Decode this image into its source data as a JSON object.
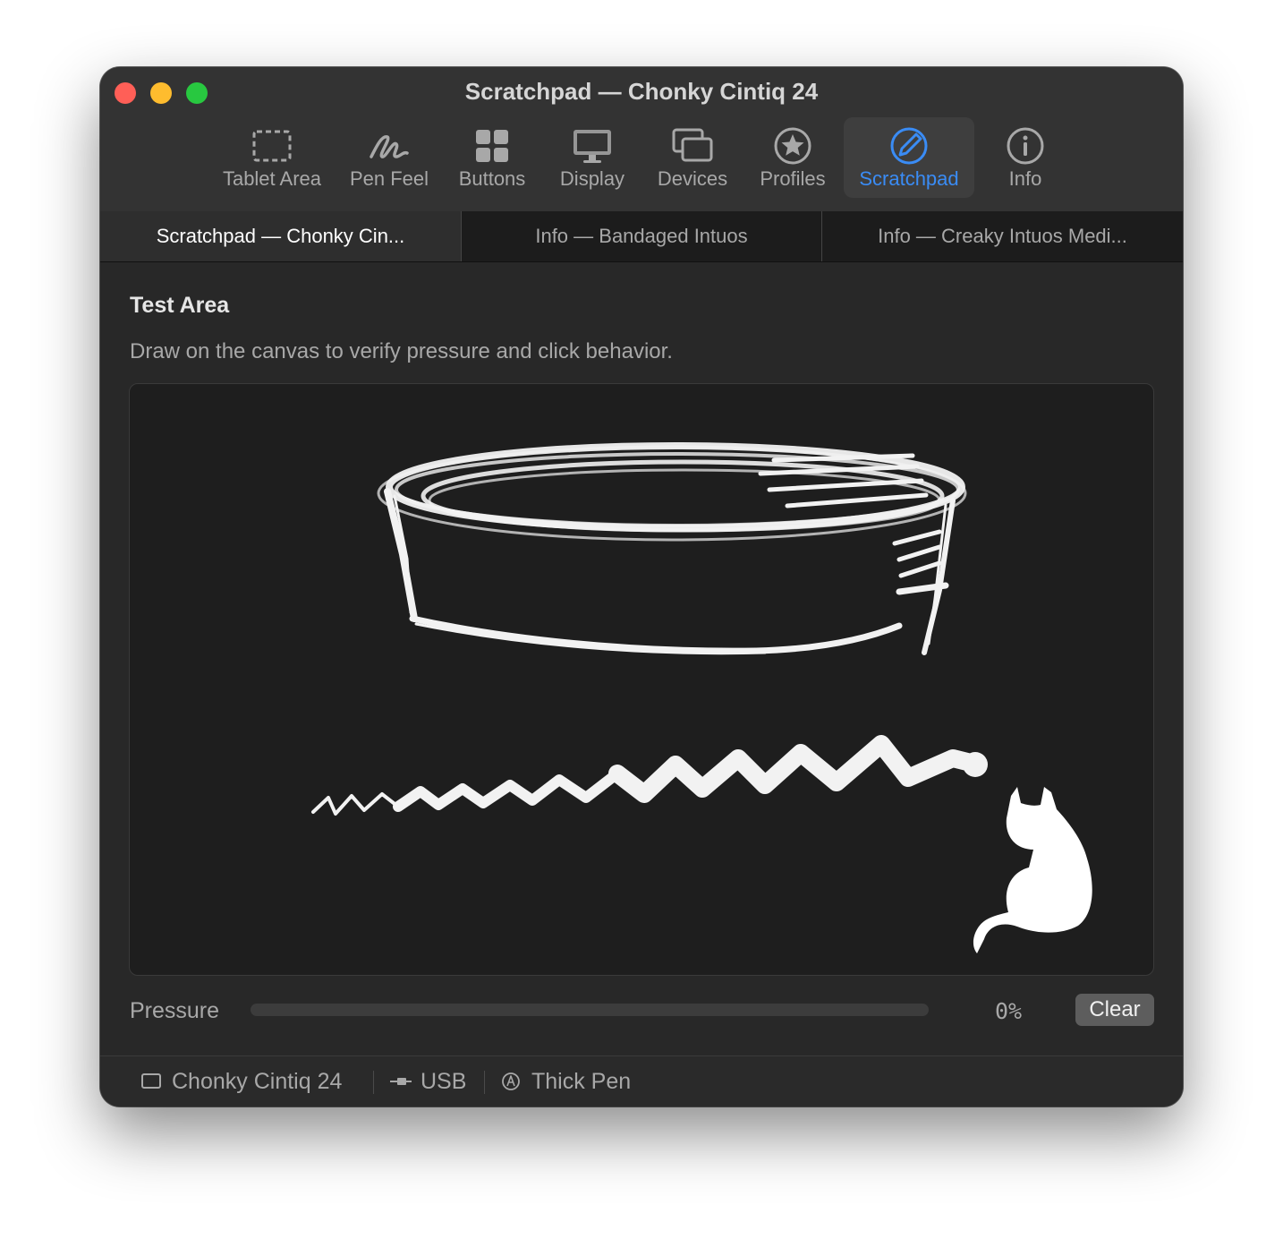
{
  "window": {
    "title": "Scratchpad — Chonky Cintiq 24"
  },
  "toolbar": {
    "items": [
      {
        "label": "Tablet Area",
        "icon": "tablet-area-icon"
      },
      {
        "label": "Pen Feel",
        "icon": "pen-feel-icon"
      },
      {
        "label": "Buttons",
        "icon": "buttons-grid-icon"
      },
      {
        "label": "Display",
        "icon": "display-icon"
      },
      {
        "label": "Devices",
        "icon": "devices-icon"
      },
      {
        "label": "Profiles",
        "icon": "star-icon"
      },
      {
        "label": "Scratchpad",
        "icon": "pencil-circle-icon",
        "active": true
      },
      {
        "label": "Info",
        "icon": "info-icon"
      }
    ]
  },
  "tabs": [
    {
      "label": "Scratchpad — Chonky Cin...",
      "active": true
    },
    {
      "label": "Info — Bandaged Intuos"
    },
    {
      "label": "Info — Creaky Intuos Medi..."
    }
  ],
  "content": {
    "title": "Test Area",
    "description": "Draw on the canvas to verify pressure and click behavior."
  },
  "pressure": {
    "label": "Pressure",
    "value_text": "0%",
    "level_percent": 0
  },
  "clear_button": {
    "label": "Clear"
  },
  "status": {
    "device": "Chonky Cintiq 24",
    "connection": "USB",
    "pen": "Thick Pen"
  },
  "colors": {
    "accent": "#3a8cf5",
    "close": "#ff5f57",
    "minimize": "#febc2e",
    "maximize": "#28c840"
  }
}
